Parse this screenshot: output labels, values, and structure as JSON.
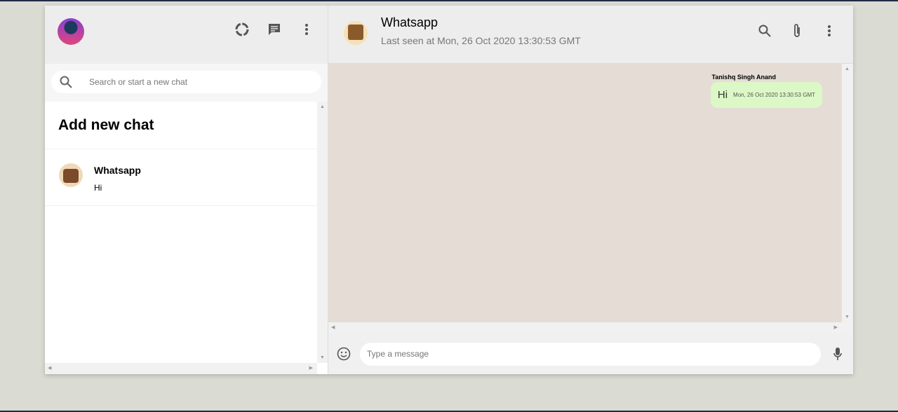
{
  "sidebar": {
    "icons": [
      "status-icon",
      "new-chat-icon",
      "menu-icon"
    ],
    "search_placeholder": "Search or start a new chat",
    "add_new_chat": "Add new chat",
    "chats": [
      {
        "name": "Whatsapp",
        "last_message": "Hi"
      }
    ]
  },
  "chat": {
    "title": "Whatsapp",
    "subtitle": "Last seen at Mon, 26 Oct 2020 13:30:53 GMT",
    "icons": [
      "search-icon",
      "attach-icon",
      "menu-icon"
    ],
    "background_color": "#e5ddd5",
    "messages": [
      {
        "sender": "Tanishq Singh Anand",
        "text": "Hi",
        "time": "Mon, 26 Oct 2020 13:30:53 GMT",
        "bubble_color": "#dcf8c6"
      }
    ],
    "input_placeholder": "Type a message"
  }
}
